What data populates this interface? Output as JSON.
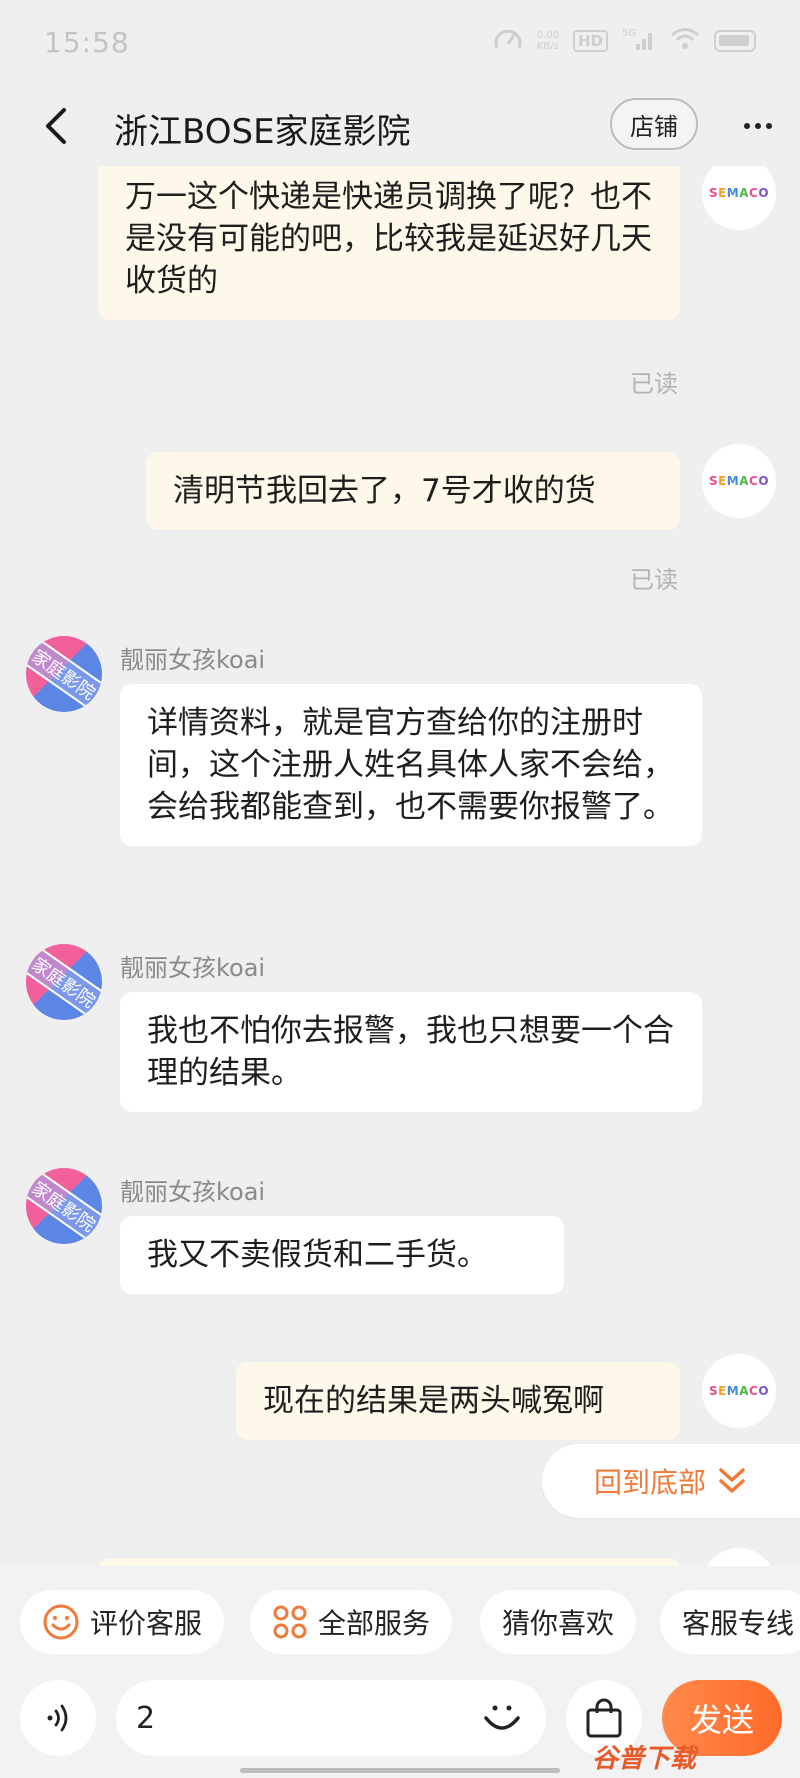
{
  "status_bar": {
    "time": "15:58",
    "net_speed_value": "0.00",
    "net_speed_unit": "KB/s",
    "hd_badge": "HD",
    "signal_label": "5G"
  },
  "header": {
    "title": "浙江BOSE家庭影院",
    "shop_label": "店铺"
  },
  "avatar_me_logo": [
    "S",
    "E",
    "M",
    "A",
    "C",
    "O"
  ],
  "avatar_them_stamp": "家庭影院",
  "messages": [
    {
      "text": "万一这个快递是快递员调换了呢？也不是没有可能的吧，比较我是延迟好几天收货的",
      "read": "已读"
    },
    {
      "text": "清明节我回去了，7号才收的货",
      "read": "已读"
    },
    {
      "nick": "靓丽女孩koai",
      "text": "详情资料，就是官方查给你的注册时间，这个注册人姓名具体人家不会给，会给我都能查到，也不需要你报警了。"
    },
    {
      "nick": "靓丽女孩koai",
      "text": "我也不怕你去报警，我也只想要一个合理的结果。"
    },
    {
      "nick": "靓丽女孩koai",
      "text": "我又不卖假货和二手货。"
    },
    {
      "text": "现在的结果是两头喊冤啊"
    }
  ],
  "scroll_to_bottom": "回到底部",
  "quick_actions": {
    "rate_service": "评价客服",
    "all_services": "全部服务",
    "guess_you_like": "猜你喜欢",
    "service_hotline": "客服专线"
  },
  "input": {
    "value": "2",
    "send_label": "发送"
  },
  "watermark": "谷普下载"
}
